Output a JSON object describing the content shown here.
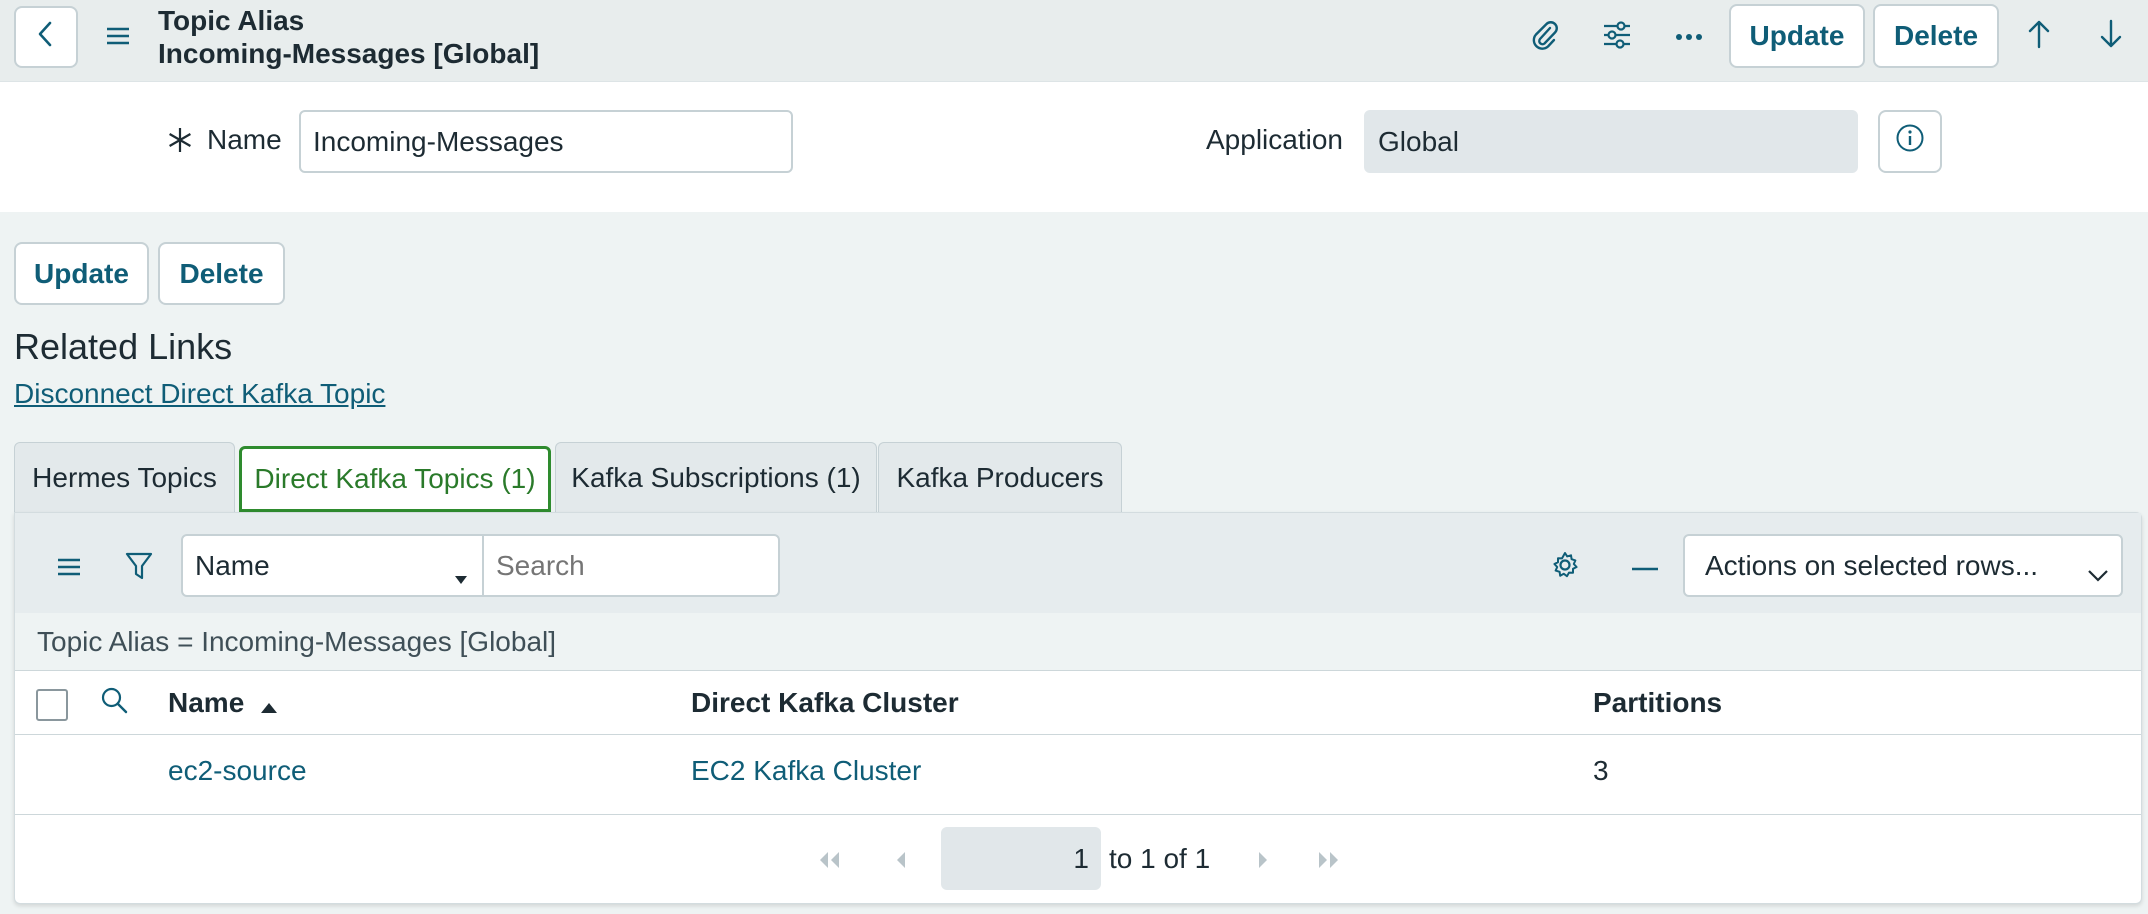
{
  "header": {
    "title_line1": "Topic Alias",
    "title_line2": "Incoming-Messages [Global]",
    "update_label": "Update",
    "delete_label": "Delete"
  },
  "form": {
    "name_label": "Name",
    "name_value": "Incoming-Messages",
    "application_label": "Application",
    "application_value": "Global"
  },
  "actions": {
    "update_label": "Update",
    "delete_label": "Delete"
  },
  "related_links": {
    "title": "Related Links",
    "links": [
      "Disconnect Direct Kafka Topic"
    ]
  },
  "tabs": [
    {
      "label": "Hermes Topics",
      "active": false
    },
    {
      "label": "Direct Kafka Topics (1)",
      "active": true
    },
    {
      "label": "Kafka Subscriptions (1)",
      "active": false
    },
    {
      "label": "Kafka Producers",
      "active": false
    }
  ],
  "list": {
    "search_field_select": "Name",
    "search_placeholder": "Search",
    "actions_select": "Actions on selected rows...",
    "filter_text": "Topic Alias = Incoming-Messages [Global]",
    "columns": [
      "Name",
      "Direct Kafka Cluster",
      "Partitions"
    ],
    "rows": [
      {
        "name": "ec2-source",
        "cluster": "EC2 Kafka Cluster",
        "partitions": "3"
      }
    ],
    "pagination": {
      "current_page": "1",
      "summary": "to 1 of 1"
    }
  },
  "colors": {
    "accent": "#0f5d77",
    "active_tab": "#2e8b2e",
    "header_bg": "#e8eded",
    "page_bg": "#eef3f3"
  }
}
